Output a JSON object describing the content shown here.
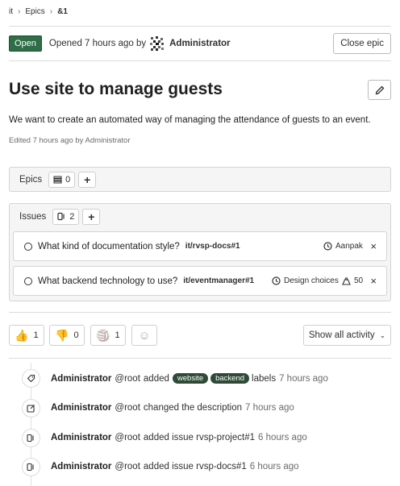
{
  "breadcrumb": {
    "group": "it",
    "section": "Epics",
    "current": "&1"
  },
  "status": {
    "badge": "Open",
    "opened_text": "Opened 7 hours ago by",
    "author": "Administrator",
    "close_label": "Close epic"
  },
  "epic": {
    "title": "Use site to manage guests",
    "description": "We want to create an automated way of managing the attendance of guests to an event.",
    "edited": "Edited 7 hours ago by Administrator"
  },
  "epics_panel": {
    "label": "Epics",
    "count": "0",
    "add_label": "+"
  },
  "issues_panel": {
    "label": "Issues",
    "count": "2",
    "add_label": "+",
    "items": [
      {
        "title": "What kind of documentation style?",
        "ref": "it/rvsp-docs#1",
        "milestone": "Aanpak",
        "weight": "",
        "remove": "×"
      },
      {
        "title": "What backend technology to use?",
        "ref": "it/eventmanager#1",
        "milestone": "Design choices",
        "weight": "50",
        "remove": "×"
      }
    ]
  },
  "awards": [
    {
      "emoji": "👍",
      "count": "1"
    },
    {
      "emoji": "👎",
      "count": "0"
    },
    {
      "emoji": "🏐",
      "count": "1"
    },
    {
      "emoji": "☺",
      "count": ""
    }
  ],
  "activity_filter": {
    "label": "Show all activity"
  },
  "timeline": [
    {
      "icon": "label-icon",
      "author": "Administrator",
      "handle": "@root",
      "action": "added",
      "labels": [
        "website",
        "backend"
      ],
      "suffix": "labels",
      "time": "7 hours ago"
    },
    {
      "icon": "pencil-square-icon",
      "author": "Administrator",
      "handle": "@root",
      "action": "changed the description",
      "time": "7 hours ago"
    },
    {
      "icon": "issues-icon",
      "author": "Administrator",
      "handle": "@root",
      "action": "added issue rvsp-project#1",
      "time": "6 hours ago"
    },
    {
      "icon": "issues-icon",
      "author": "Administrator",
      "handle": "@root",
      "action": "added issue rvsp-docs#1",
      "time": "6 hours ago"
    }
  ]
}
